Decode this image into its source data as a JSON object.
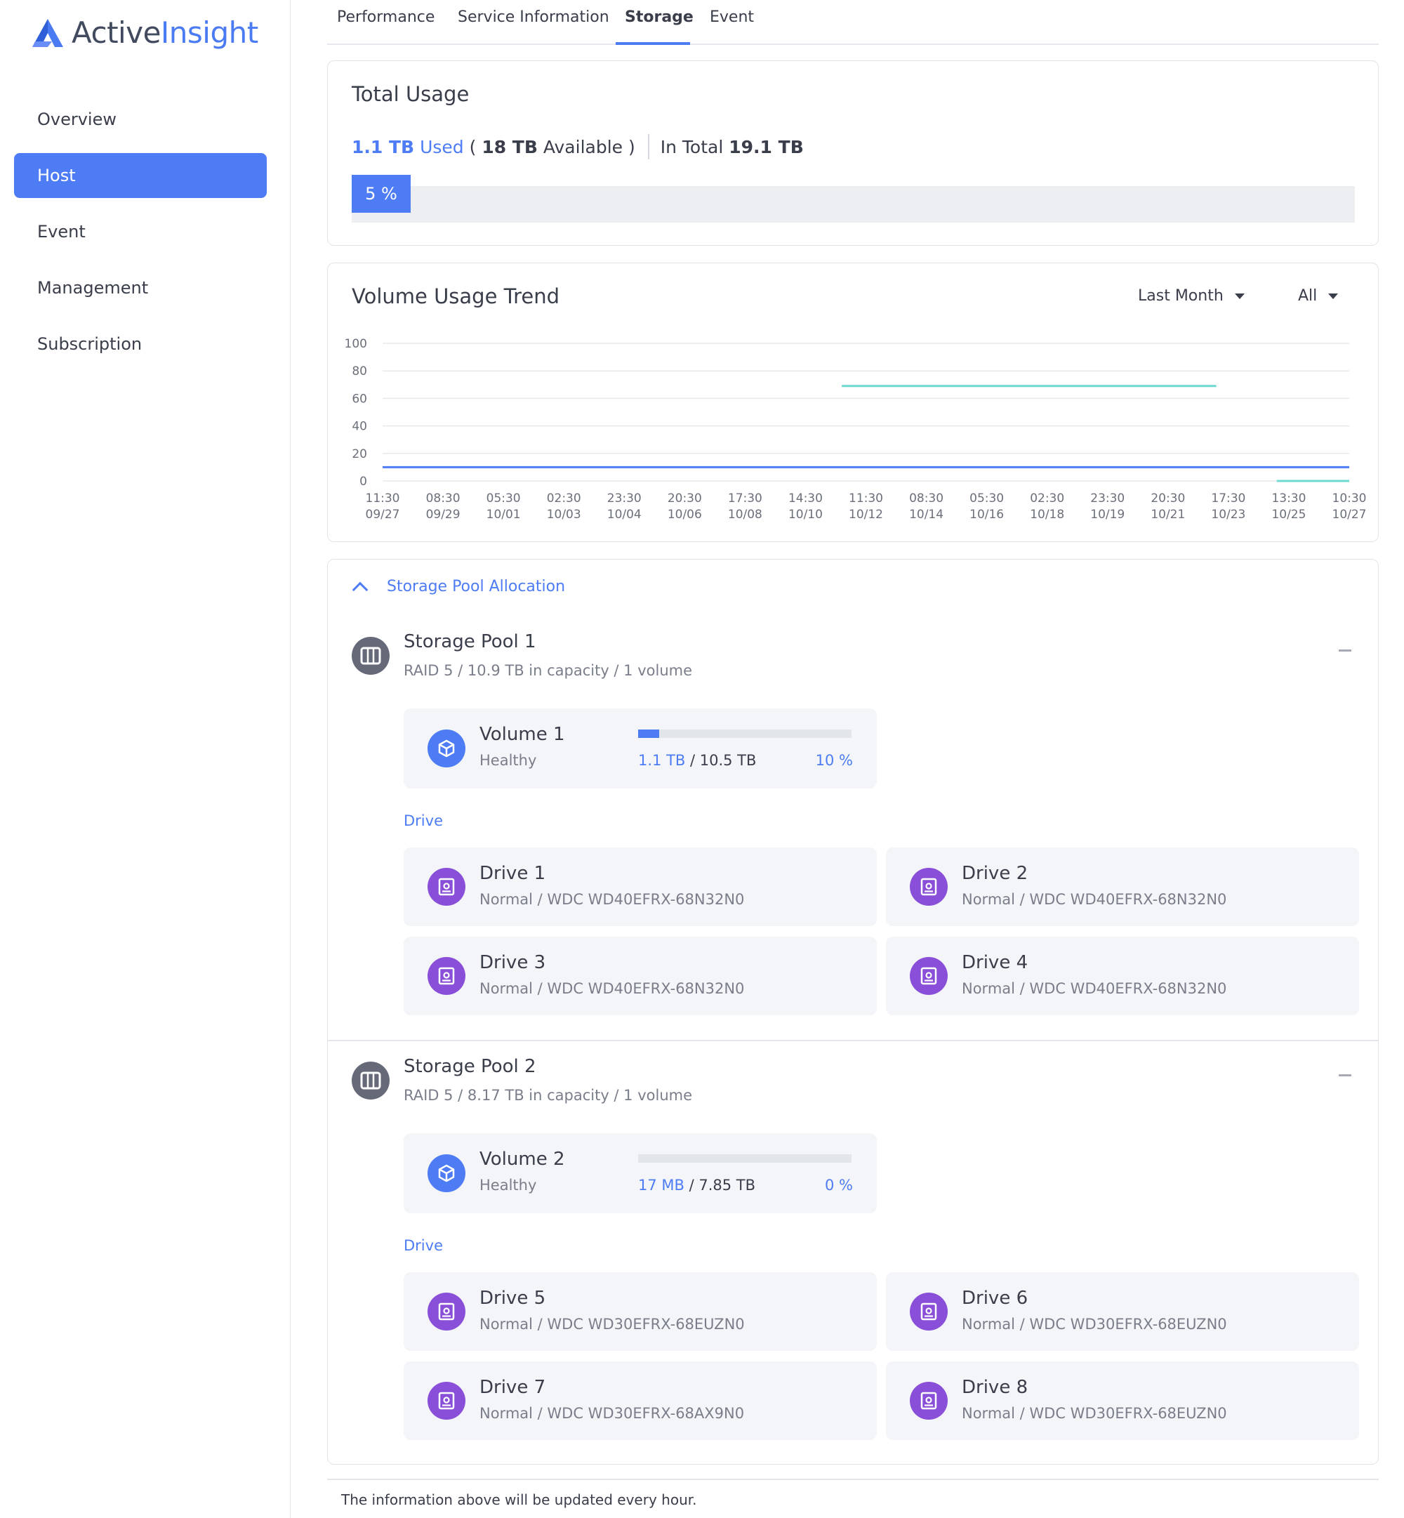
{
  "app": {
    "logo_part1": "Active",
    "logo_part2": "Insight",
    "brand_color": "#4d7cf4"
  },
  "sidebar": {
    "items": [
      {
        "label": "Overview",
        "active": false
      },
      {
        "label": "Host",
        "active": true
      },
      {
        "label": "Event",
        "active": false
      },
      {
        "label": "Management",
        "active": false
      },
      {
        "label": "Subscription",
        "active": false
      }
    ]
  },
  "tabs": [
    {
      "label": "Performance",
      "active": false
    },
    {
      "label": "Service Information",
      "active": false
    },
    {
      "label": "Storage",
      "active": true
    },
    {
      "label": "Event",
      "active": false
    }
  ],
  "total_usage": {
    "title": "Total Usage",
    "used_value": "1.1 TB",
    "used_label": "Used",
    "open_paren": "(",
    "available_value": "18 TB",
    "available_label": "Available )",
    "total_label": "In Total",
    "total_value": "19.1 TB",
    "percent_text": "5 %",
    "percent": 5
  },
  "trend": {
    "title": "Volume Usage Trend",
    "range_dropdown": "Last Month",
    "filter_dropdown": "All"
  },
  "chart_data": {
    "type": "line",
    "ylim": [
      0,
      100
    ],
    "yticks": [
      "100",
      "80",
      "60",
      "40",
      "20",
      "0"
    ],
    "xticks": [
      [
        "11:30",
        "09/27"
      ],
      [
        "08:30",
        "09/29"
      ],
      [
        "05:30",
        "10/01"
      ],
      [
        "02:30",
        "10/03"
      ],
      [
        "23:30",
        "10/04"
      ],
      [
        "20:30",
        "10/06"
      ],
      [
        "17:30",
        "10/08"
      ],
      [
        "14:30",
        "10/10"
      ],
      [
        "11:30",
        "10/12"
      ],
      [
        "08:30",
        "10/14"
      ],
      [
        "05:30",
        "10/16"
      ],
      [
        "02:30",
        "10/18"
      ],
      [
        "23:30",
        "10/19"
      ],
      [
        "20:30",
        "10/21"
      ],
      [
        "17:30",
        "10/23"
      ],
      [
        "13:30",
        "10/25"
      ],
      [
        "10:30",
        "10/27"
      ]
    ],
    "grid": true,
    "series": [
      {
        "color": "#4d7cf4",
        "segments": [
          {
            "x_start": 0,
            "x_end": 16,
            "y": 10
          }
        ]
      },
      {
        "color": "#6fd8cf",
        "segments": [
          {
            "x_start": 7.6,
            "x_end": 13.8,
            "y": 69
          },
          {
            "x_start": 14.8,
            "x_end": 16,
            "y": 0
          }
        ]
      }
    ]
  },
  "pools_section": {
    "toggle_label": "Storage Pool Allocation"
  },
  "pools": [
    {
      "name": "Storage Pool 1",
      "subtitle": "RAID 5 / 10.9 TB in capacity / 1 volume",
      "volume": {
        "name": "Volume 1",
        "status": "Healthy",
        "used": "1.1 TB",
        "capacity": "/ 10.5 TB",
        "percent_text": "10 %",
        "percent": 10
      },
      "drive_label": "Drive",
      "drives": [
        {
          "name": "Drive 1",
          "info": "Normal / WDC WD40EFRX-68N32N0"
        },
        {
          "name": "Drive 2",
          "info": "Normal / WDC WD40EFRX-68N32N0"
        },
        {
          "name": "Drive 3",
          "info": "Normal / WDC WD40EFRX-68N32N0"
        },
        {
          "name": "Drive 4",
          "info": "Normal / WDC WD40EFRX-68N32N0"
        }
      ]
    },
    {
      "name": "Storage Pool 2",
      "subtitle": "RAID 5 / 8.17 TB in capacity / 1 volume",
      "volume": {
        "name": "Volume 2",
        "status": "Healthy",
        "used": "17 MB",
        "capacity": "/ 7.85 TB",
        "percent_text": "0 %",
        "percent": 0
      },
      "drive_label": "Drive",
      "drives": [
        {
          "name": "Drive 5",
          "info": "Normal / WDC WD30EFRX-68EUZN0"
        },
        {
          "name": "Drive 6",
          "info": "Normal / WDC WD30EFRX-68EUZN0"
        },
        {
          "name": "Drive 7",
          "info": "Normal / WDC WD30EFRX-68AX9N0"
        },
        {
          "name": "Drive 8",
          "info": "Normal / WDC WD30EFRX-68EUZN0"
        }
      ]
    }
  ],
  "footer": {
    "note": "The information above will be updated every hour."
  }
}
